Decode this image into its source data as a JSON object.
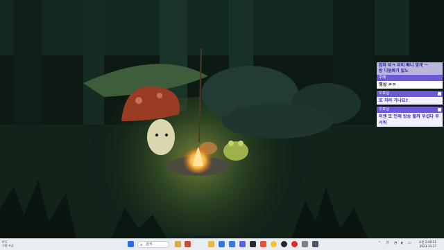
{
  "chat": {
    "top_fragment_line1": "엄마 비ㅋ 라이 빠니 맞게 ㅡ",
    "top_fragment_line2": "랑 디둠봐가 없노",
    "messages": [
      {
        "user": "우혜",
        "text": "영상 ㄹㅇ",
        "style": "plain"
      },
      {
        "user": "우호님",
        "text": "또 자러 가나요?",
        "style": "highlight"
      },
      {
        "user": "우호님",
        "text": "이젠 또 언제 방송 할까 무섭다 무서워",
        "style": "highlight"
      }
    ]
  },
  "taskbar": {
    "weather_line1": "9°C",
    "weather_line2": "구름 조금",
    "search_placeholder": "검색",
    "tray_lang": "가",
    "clock_time": "오전 2:40:11",
    "clock_date": "2023-10-17",
    "icons": [
      "windows-start-icon",
      "search-icon",
      "task-view-icon",
      "file-explorer-icon",
      "store-icon",
      "mail-icon",
      "chrome-icon",
      "discord-icon",
      "obs-icon",
      "steam-icon",
      "settings-icon",
      "calculator-icon"
    ]
  },
  "colors": {
    "chat_header": "#6f5ad6",
    "chat_text": "#3a2bb6",
    "taskbar_bg": "#e9ecf1"
  }
}
